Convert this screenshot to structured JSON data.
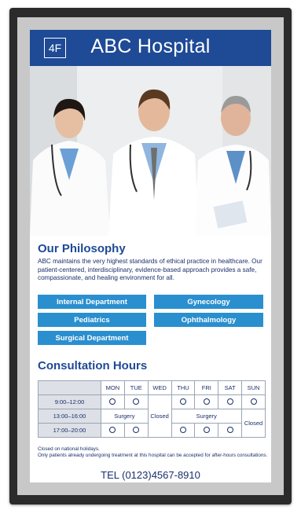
{
  "header": {
    "floor": "4F",
    "name": "ABC Hospital"
  },
  "philosophy": {
    "title": "Our Philosophy",
    "text": "ABC maintains the very highest standards of ethical practice in healthcare. Our patient-centered, interdisciplinary, evidence-based approach provides a safe, compassionate, and healing environment for all."
  },
  "departments": [
    "Internal Department",
    "Gynecology",
    "Pediatrics",
    "Ophthalmology",
    "Surgical Department"
  ],
  "hours": {
    "title": "Consultation Hours",
    "days": [
      "MON",
      "TUE",
      "WED",
      "THU",
      "FRI",
      "SAT",
      "SUN"
    ],
    "slots": [
      "9:00–12:00",
      "13:00–16:00",
      "17:00–20:00"
    ],
    "surgery": "Surgery",
    "closed": "Closed"
  },
  "notes": {
    "line1": "Closed on national holidays.",
    "line2": "Only patients already undergoing treatment at this hospital can be accepted for after-hours consultations."
  },
  "tel": "TEL (0123)4567-8910",
  "colors": {
    "header": "#1e4a96",
    "dept_button": "#2a8fcf",
    "text": "#1b2f6b"
  }
}
